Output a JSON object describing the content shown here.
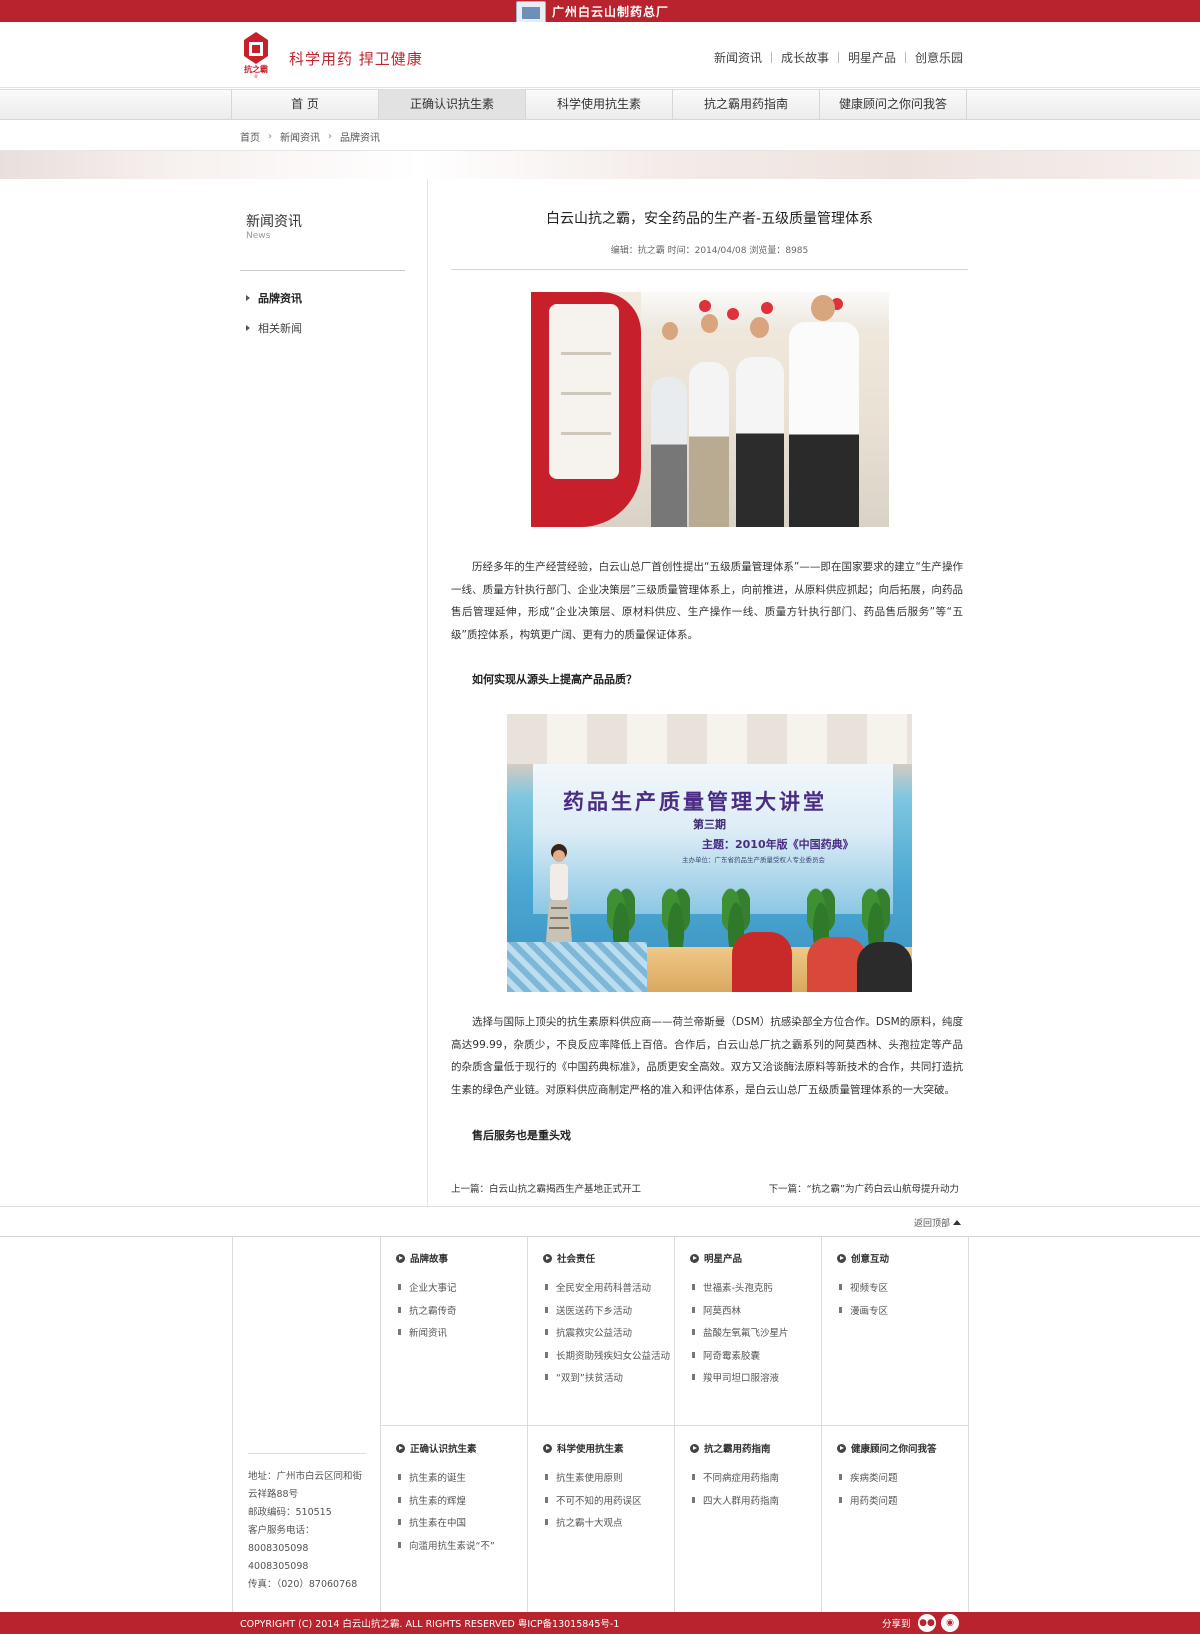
{
  "topbar": {
    "brand": "广州白云山制药总厂"
  },
  "header": {
    "logo_text": "抗之霸",
    "slogan": "科学用药  捍卫健康",
    "links": [
      "新闻资讯",
      "成长故事",
      "明星产品",
      "创意乐园"
    ]
  },
  "nav": {
    "items": [
      "首  页",
      "正确认识抗生素",
      "科学使用抗生素",
      "抗之霸用药指南",
      "健康顾问之你问我答"
    ],
    "active_index": 1
  },
  "breadcrumb": [
    "首页",
    "新闻资讯",
    "品牌资讯"
  ],
  "sidebar": {
    "title": "新闻资讯",
    "subtitle": "News",
    "items": [
      {
        "label": "品牌资讯",
        "active": true
      },
      {
        "label": "相关新闻",
        "active": false
      }
    ]
  },
  "article": {
    "title": "白云山抗之霸，安全药品的生产者-五级质量管理体系",
    "meta": "编辑：抗之霸    时间：2014/04/08    浏览量：8985",
    "para1": "历经多年的生产经营经验，白云山总厂首创性提出“五级质量管理体系”——即在国家要求的建立“生产操作一线、质量方针执行部门、企业决策层”三级质量管理体系上，向前推进，从原料供应抓起；向后拓展，向药品售后管理延伸，形成“企业决策层、原材料供应、生产操作一线、质量方针执行部门、药品售后服务”等“五级”质控体系，构筑更广阔、更有力的质量保证体系。",
    "subhead1": "如何实现从源头上提高产品品质？",
    "photo2": {
      "banner_title": "药品生产质量管理大讲堂",
      "phase": "第三期",
      "topic": "主题：2010年版《中国药典》",
      "small": "主办单位：广东省药品生产质量受权人专业委员会"
    },
    "para2": "选择与国际上顶尖的抗生素原料供应商——荷兰帝斯曼（DSM）抗感染部全方位合作。DSM的原料，纯度高达99.99，杂质少，不良反应率降低上百倍。合作后，白云山总厂抗之霸系列的阿莫西林、头孢拉定等产品的杂质含量低于现行的《中国药典标准》，品质更安全高效。双方又洽谈酶法原料等新技术的合作，共同打造抗生素的绿色产业链。对原料供应商制定严格的准入和评估体系，是白云山总厂五级质量管理体系的一大突破。",
    "subhead2": "售后服务也是重头戏",
    "prev": "上一篇：白云山抗之霸揭西生产基地正式开工",
    "next": "下一篇：“抗之霸”为广药白云山航母提升动力"
  },
  "back_to_top": "返回顶部",
  "footer": {
    "columns_top": [
      {
        "heading": "品牌故事",
        "items": [
          "企业大事记",
          "抗之霸传奇",
          "新闻资讯"
        ]
      },
      {
        "heading": "社会责任",
        "items": [
          "全民安全用药科普活动",
          "送医送药下乡活动",
          "抗震救灾公益活动",
          "长期资助残疾妇女公益活动",
          "“双到”扶贫活动"
        ]
      },
      {
        "heading": "明星产品",
        "items": [
          "世福素-头孢克肟",
          "阿莫西林",
          "盐酸左氧氟飞沙星片",
          "阿奇霉素胶囊",
          "羧甲司坦口服溶液"
        ]
      },
      {
        "heading": "创意互动",
        "items": [
          "视频专区",
          "漫画专区"
        ]
      }
    ],
    "columns_bottom": [
      {
        "heading": "正确认识抗生素",
        "items": [
          "抗生素的诞生",
          "抗生素的辉煌",
          "抗生素在中国",
          "向滥用抗生素说“不”"
        ]
      },
      {
        "heading": "科学使用抗生素",
        "items": [
          "抗生素使用原则",
          "不可不知的用药误区",
          "抗之霸十大观点"
        ]
      },
      {
        "heading": "抗之霸用药指南",
        "items": [
          "不同病症用药指南",
          "四大人群用药指南"
        ]
      },
      {
        "heading": "健康顾问之你问我答",
        "items": [
          "疾病类问题",
          "用药类问题"
        ]
      }
    ],
    "address": {
      "addr": "地址：广州市白云区同和街云祥路88号",
      "postcode": "邮政编码：510515",
      "service_label": "客户服务电话：8008305098",
      "service2": "4008305098",
      "fax": "传真：（020）87060768"
    }
  },
  "bottombar": {
    "copyright": "COPYRIGHT (C) 2014 白云山抗之霸. ALL RIGHTS RESERVED   粤ICP备13015845号-1",
    "share": "分享到"
  },
  "colors": {
    "brand_red": "#b8232e",
    "slogan_red": "#c0252f"
  }
}
